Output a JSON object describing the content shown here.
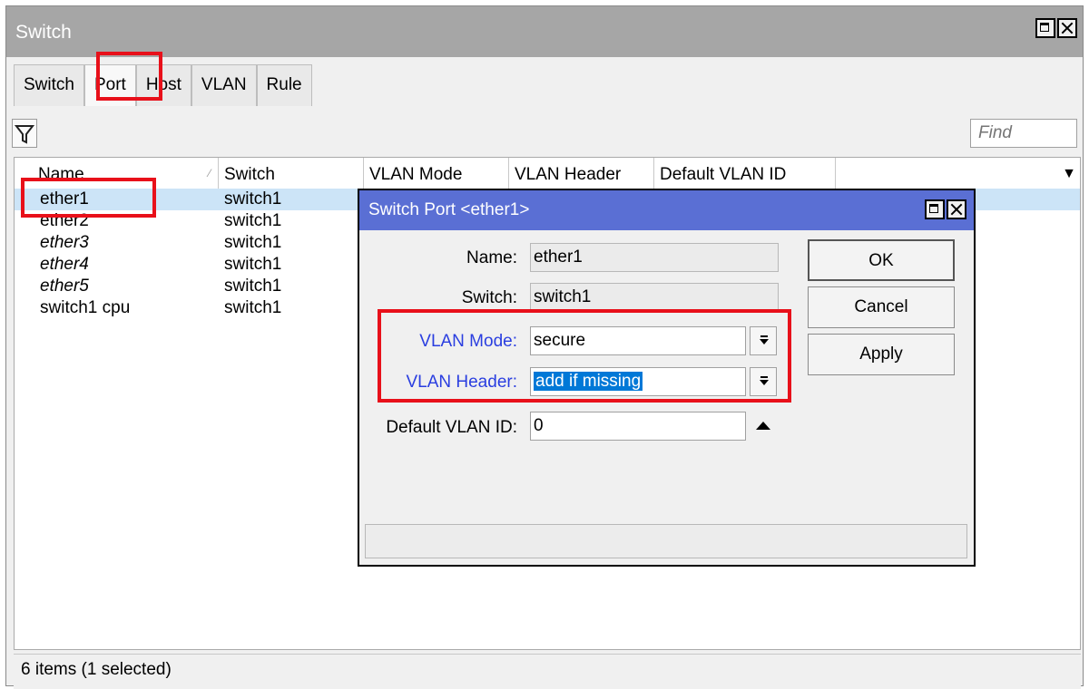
{
  "window": {
    "title": "Switch"
  },
  "tabs": [
    "Switch",
    "Port",
    "Host",
    "VLAN",
    "Rule"
  ],
  "toolbar": {
    "find_placeholder": "Find",
    "filter_icon": "filter-icon"
  },
  "table": {
    "columns": [
      "Name",
      "Switch",
      "VLAN Mode",
      "VLAN Header",
      "Default VLAN ID"
    ],
    "rows": [
      {
        "name": "ether1",
        "switch": "switch1"
      },
      {
        "name": "ether2",
        "switch": "switch1"
      },
      {
        "name": "ether3",
        "switch": "switch1"
      },
      {
        "name": "ether4",
        "switch": "switch1"
      },
      {
        "name": "ether5",
        "switch": "switch1"
      },
      {
        "name": "switch1 cpu",
        "switch": "switch1"
      }
    ]
  },
  "status": "6 items (1 selected)",
  "dialog": {
    "title": "Switch Port <ether1>",
    "name_label": "Name:",
    "name_value": "ether1",
    "switch_label": "Switch:",
    "switch_value": "switch1",
    "vlan_mode_label": "VLAN Mode:",
    "vlan_mode_value": "secure",
    "vlan_header_label": "VLAN Header:",
    "vlan_header_value": "add if missing",
    "default_vlan_label": "Default VLAN ID:",
    "default_vlan_value": "0",
    "ok": "OK",
    "cancel": "Cancel",
    "apply": "Apply"
  },
  "colors": {
    "highlight": "#e8101a",
    "dialog_title": "#5a6fd4",
    "selected_row": "#cce4f7",
    "blue_label": "#2a3ee0"
  }
}
